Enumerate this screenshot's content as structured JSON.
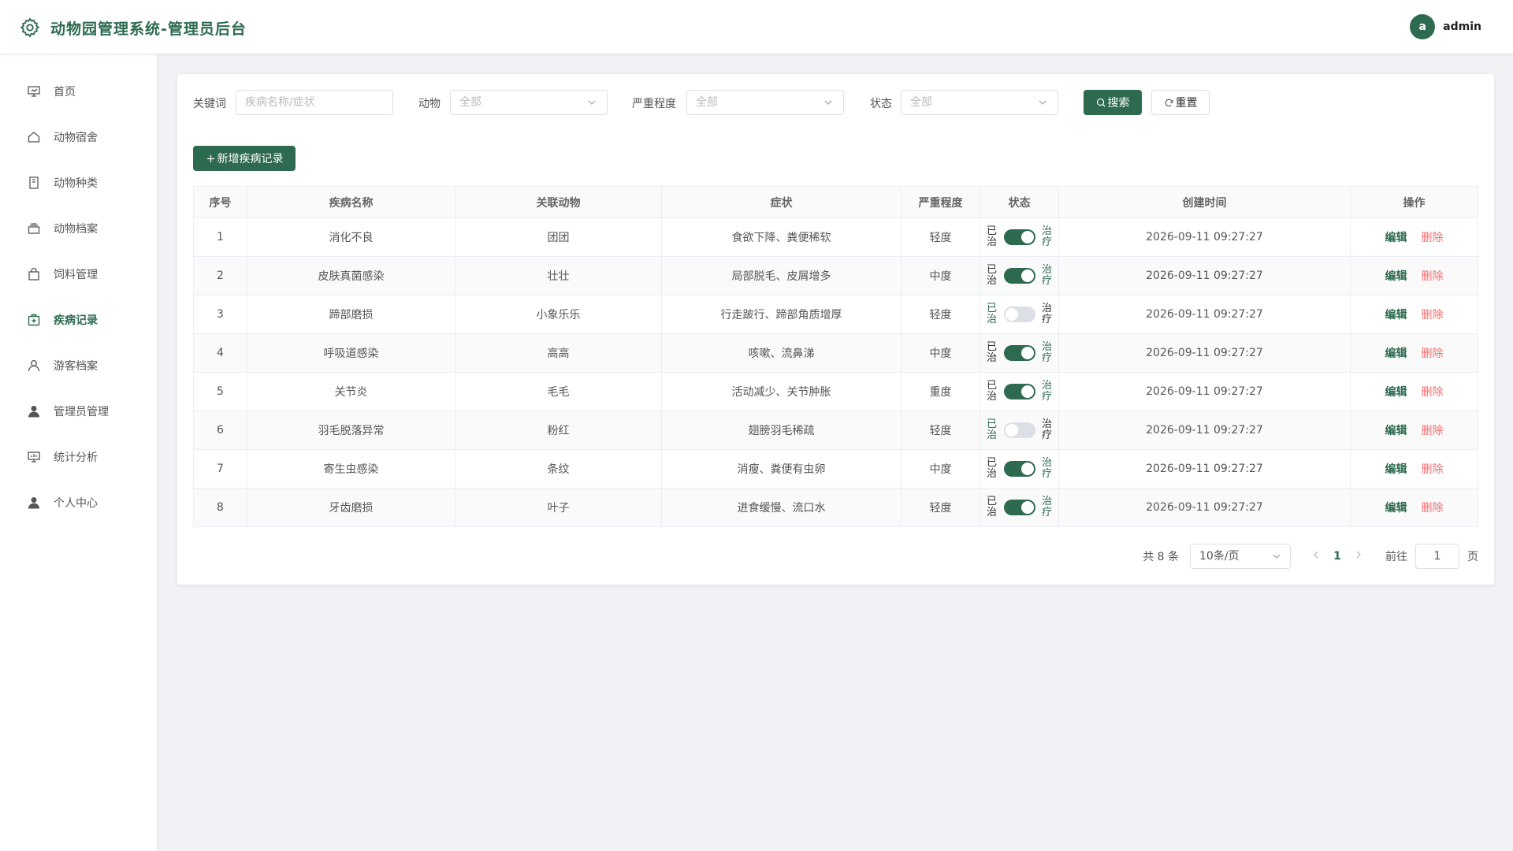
{
  "header": {
    "title": "动物园管理系统-管理员后台",
    "avatar_letter": "a",
    "username": "admin"
  },
  "sidebar": {
    "items": [
      {
        "label": "首页",
        "icon": "dashboard-icon"
      },
      {
        "label": "动物宿舍",
        "icon": "home-icon"
      },
      {
        "label": "动物种类",
        "icon": "notebook-icon"
      },
      {
        "label": "动物档案",
        "icon": "files-icon"
      },
      {
        "label": "饲料管理",
        "icon": "bag-icon"
      },
      {
        "label": "疾病记录",
        "icon": "medical-box-icon"
      },
      {
        "label": "游客档案",
        "icon": "user-icon"
      },
      {
        "label": "管理员管理",
        "icon": "user-filled-icon"
      },
      {
        "label": "统计分析",
        "icon": "data-board-icon"
      },
      {
        "label": "个人中心",
        "icon": "user-filled-icon"
      }
    ],
    "active_index": 5
  },
  "filters": {
    "keyword_label": "关键词",
    "keyword_placeholder": "疾病名称/症状",
    "animal_label": "动物",
    "animal_value": "全部",
    "severity_label": "严重程度",
    "severity_value": "全部",
    "status_label": "状态",
    "status_value": "全部",
    "search_label": "搜索",
    "reset_label": "重置"
  },
  "toolbar": {
    "add_label": "新增疾病记录"
  },
  "table": {
    "columns": [
      "序号",
      "疾病名称",
      "关联动物",
      "症状",
      "严重程度",
      "状态",
      "创建时间",
      "操作"
    ],
    "status_left": "已治",
    "status_right": "治疗",
    "edit_label": "编辑",
    "delete_label": "删除",
    "rows": [
      {
        "index": "1",
        "disease": "消化不良",
        "animal": "团团",
        "symptom": "食欲下降、粪便稀软",
        "severity": "轻度",
        "cured": true,
        "created": "2026-09-11 09:27:27"
      },
      {
        "index": "2",
        "disease": "皮肤真菌感染",
        "animal": "壮壮",
        "symptom": "局部脱毛、皮屑增多",
        "severity": "中度",
        "cured": true,
        "created": "2026-09-11 09:27:27"
      },
      {
        "index": "3",
        "disease": "蹄部磨损",
        "animal": "小象乐乐",
        "symptom": "行走跛行、蹄部角质增厚",
        "severity": "轻度",
        "cured": false,
        "created": "2026-09-11 09:27:27"
      },
      {
        "index": "4",
        "disease": "呼吸道感染",
        "animal": "高高",
        "symptom": "咳嗽、流鼻涕",
        "severity": "中度",
        "cured": true,
        "created": "2026-09-11 09:27:27"
      },
      {
        "index": "5",
        "disease": "关节炎",
        "animal": "毛毛",
        "symptom": "活动减少、关节肿胀",
        "severity": "重度",
        "cured": true,
        "created": "2026-09-11 09:27:27"
      },
      {
        "index": "6",
        "disease": "羽毛脱落异常",
        "animal": "粉红",
        "symptom": "翅膀羽毛稀疏",
        "severity": "轻度",
        "cured": false,
        "created": "2026-09-11 09:27:27"
      },
      {
        "index": "7",
        "disease": "寄生虫感染",
        "animal": "条纹",
        "symptom": "消瘦、粪便有虫卵",
        "severity": "中度",
        "cured": true,
        "created": "2026-09-11 09:27:27"
      },
      {
        "index": "8",
        "disease": "牙齿磨损",
        "animal": "叶子",
        "symptom": "进食缓慢、流口水",
        "severity": "轻度",
        "cured": true,
        "created": "2026-09-11 09:27:27"
      }
    ]
  },
  "pagination": {
    "total_text": "共 8 条",
    "page_size": "10条/页",
    "current_page": "1",
    "goto_label": "前往",
    "goto_value": "1",
    "page_suffix": "页"
  },
  "colors": {
    "primary": "#2d6a4f",
    "danger": "#f56c6c"
  }
}
